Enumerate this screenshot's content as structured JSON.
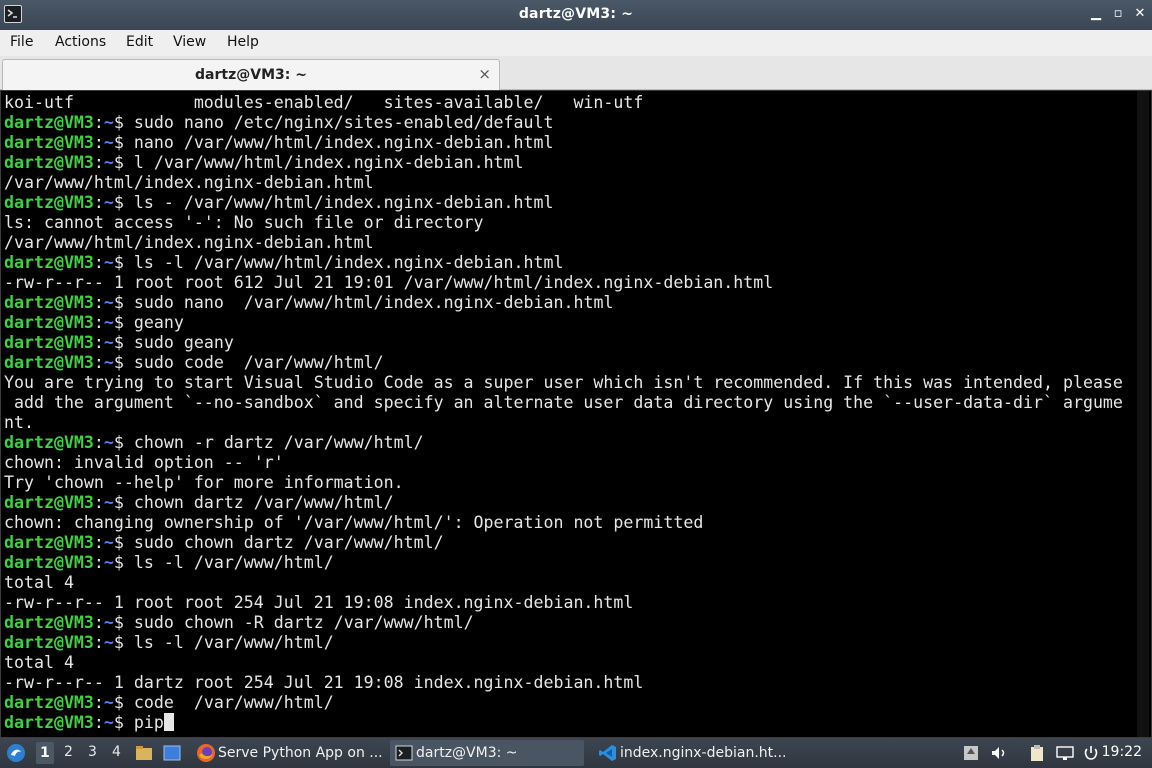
{
  "window": {
    "title": "dartz@VM3: ~",
    "minimize_glyph": "▁",
    "maximize_glyph": "▫",
    "close_glyph": "✕"
  },
  "menu": [
    "File",
    "Actions",
    "Edit",
    "View",
    "Help"
  ],
  "tab": {
    "label": "dartz@VM3: ~",
    "close_glyph": "×"
  },
  "prompt": {
    "user_host": "dartz@VM3",
    "sep": ":",
    "path": "~",
    "symbol": "$ "
  },
  "terminal_lines": [
    {
      "out": "koi-utf            modules-enabled/   sites-available/   win-utf"
    },
    {
      "cmd": "sudo nano /etc/nginx/sites-enabled/default"
    },
    {
      "cmd": "nano /var/www/html/index.nginx-debian.html"
    },
    {
      "cmd": "l /var/www/html/index.nginx-debian.html"
    },
    {
      "out": "/var/www/html/index.nginx-debian.html"
    },
    {
      "cmd": "ls - /var/www/html/index.nginx-debian.html"
    },
    {
      "out": "ls: cannot access '-': No such file or directory"
    },
    {
      "out": "/var/www/html/index.nginx-debian.html"
    },
    {
      "cmd": "ls -l /var/www/html/index.nginx-debian.html"
    },
    {
      "out": "-rw-r--r-- 1 root root 612 Jul 21 19:01 /var/www/html/index.nginx-debian.html"
    },
    {
      "cmd": "sudo nano  /var/www/html/index.nginx-debian.html"
    },
    {
      "cmd": "geany"
    },
    {
      "cmd": "sudo geany"
    },
    {
      "cmd": "sudo code  /var/www/html/"
    },
    {
      "out": "You are trying to start Visual Studio Code as a super user which isn't recommended. If this was intended, please"
    },
    {
      "out": " add the argument `--no-sandbox` and specify an alternate user data directory using the `--user-data-dir` argume"
    },
    {
      "out": "nt."
    },
    {
      "cmd": "chown -r dartz /var/www/html/"
    },
    {
      "out": "chown: invalid option -- 'r'"
    },
    {
      "out": "Try 'chown --help' for more information."
    },
    {
      "cmd": "chown dartz /var/www/html/"
    },
    {
      "out": "chown: changing ownership of '/var/www/html/': Operation not permitted"
    },
    {
      "cmd": "sudo chown dartz /var/www/html/"
    },
    {
      "cmd": "ls -l /var/www/html/"
    },
    {
      "out": "total 4"
    },
    {
      "out": "-rw-r--r-- 1 root root 254 Jul 21 19:08 index.nginx-debian.html"
    },
    {
      "cmd": "sudo chown -R dartz /var/www/html/"
    },
    {
      "cmd": "ls -l /var/www/html/"
    },
    {
      "out": "total 4"
    },
    {
      "out": "-rw-r--r-- 1 dartz root 254 Jul 21 19:08 index.nginx-debian.html"
    },
    {
      "cmd": "code  /var/www/html/"
    },
    {
      "cmd": "pip",
      "cursor": true
    }
  ],
  "taskbar": {
    "workspaces": [
      "1",
      "2",
      "3",
      "4"
    ],
    "active_workspace": "1",
    "tasks": [
      {
        "label": "Serve Python App on ...",
        "icon": "firefox-icon",
        "active": false
      },
      {
        "label": "dartz@VM3: ~",
        "icon": "terminal-icon",
        "active": true
      },
      {
        "label": "index.nginx-debian.ht...",
        "icon": "vscode-icon",
        "active": false
      }
    ],
    "clock": "19:22"
  },
  "colors": {
    "prompt_user": "#3fd13f",
    "prompt_path": "#5c7cff",
    "terminal_bg": "#000000",
    "terminal_fg": "#e6e6e6"
  }
}
